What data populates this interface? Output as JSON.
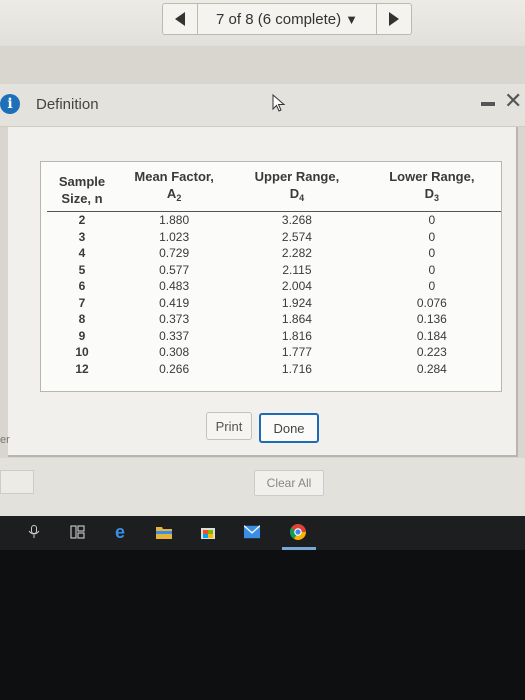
{
  "pager": {
    "label": "7 of 8 (6 complete)"
  },
  "dialog": {
    "title": "Definition"
  },
  "table": {
    "headers": {
      "n_line1": "Sample",
      "n_line2": "Size, n",
      "a_line1": "Mean Factor,",
      "a_sym": "A",
      "a_sub": "2",
      "u_line1": "Upper Range,",
      "u_sym": "D",
      "u_sub": "4",
      "l_line1": "Lower Range,",
      "l_sym": "D",
      "l_sub": "3"
    },
    "rows": [
      [
        "2",
        "1.880",
        "3.268",
        "0"
      ],
      [
        "3",
        "1.023",
        "2.574",
        "0"
      ],
      [
        "4",
        "0.729",
        "2.282",
        "0"
      ],
      [
        "5",
        "0.577",
        "2.115",
        "0"
      ],
      [
        "6",
        "0.483",
        "2.004",
        "0"
      ],
      [
        "7",
        "0.419",
        "1.924",
        "0.076"
      ],
      [
        "8",
        "0.373",
        "1.864",
        "0.136"
      ],
      [
        "9",
        "0.337",
        "1.816",
        "0.184"
      ],
      [
        "10",
        "0.308",
        "1.777",
        "0.223"
      ],
      [
        "12",
        "0.266",
        "1.716",
        "0.284"
      ]
    ]
  },
  "buttons": {
    "print": "Print",
    "done": "Done",
    "clear_all": "Clear All"
  },
  "background": {
    "edge_text": "er"
  },
  "icons": {
    "info": "info-icon",
    "close": "close-icon",
    "minimize": "minimize-icon",
    "prev": "prev-arrow-icon",
    "next": "next-arrow-icon"
  },
  "colors": {
    "accent": "#1f6ab5",
    "info_blue": "#1d6fb8",
    "taskbar": "#1d1e20"
  }
}
